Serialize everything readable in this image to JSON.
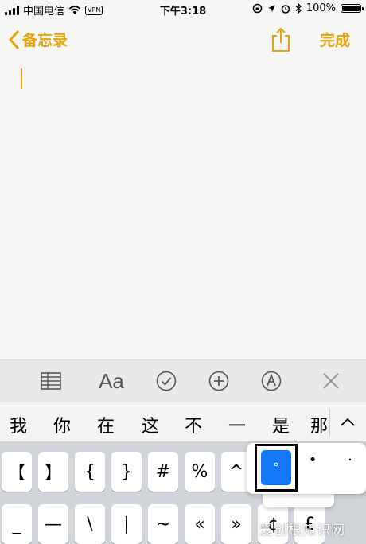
{
  "status": {
    "carrier": "中国电信",
    "vpn": "VPN",
    "time": "下午3:18",
    "battery": "100%"
  },
  "nav": {
    "back_label": "备忘录",
    "done_label": "完成"
  },
  "colors": {
    "accent": "#e5a40b",
    "selected": "#1477f8"
  },
  "toolbar": {
    "aa_label": "Aa",
    "icons": [
      "table-icon",
      "format-text-icon",
      "checklist-icon",
      "add-icon",
      "markup-icon",
      "close-icon"
    ]
  },
  "candidates": [
    "我",
    "你",
    "在",
    "这",
    "不",
    "一",
    "是",
    "那"
  ],
  "keys_row1": [
    "【",
    "】",
    "{",
    "}",
    "#",
    "%",
    "^"
  ],
  "keys_row2": [
    "_",
    "—",
    "\\",
    "|",
    "~",
    "«",
    "»",
    "¢",
    "£"
  ],
  "popup": {
    "selected": "°",
    "options": [
      "•",
      "·"
    ]
  },
  "watermark": "爱创根知识网"
}
